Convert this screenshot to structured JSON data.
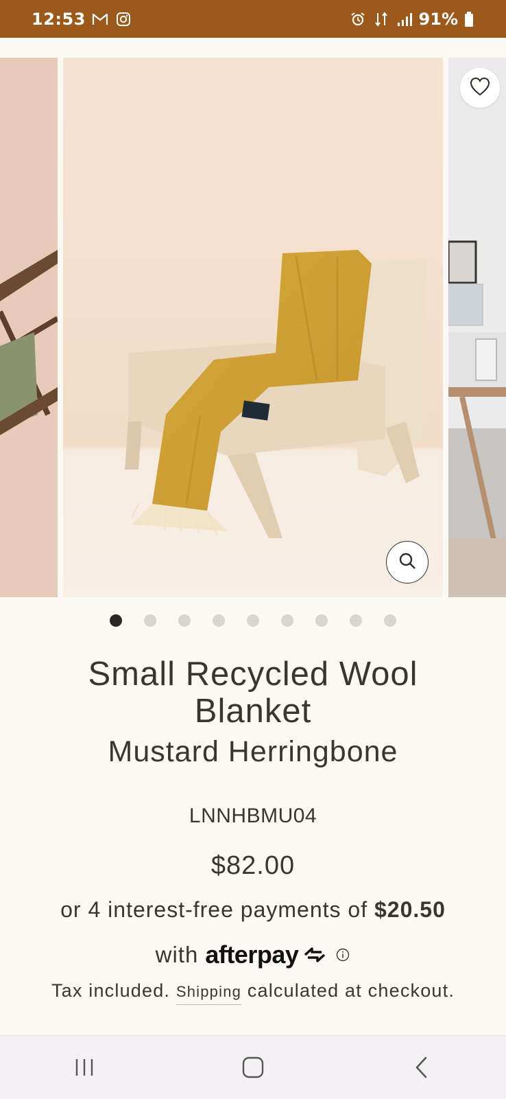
{
  "status_bar": {
    "time": "12:53",
    "battery": "91%",
    "left_icons": [
      "gmail-icon",
      "instagram-icon"
    ],
    "right_icons": [
      "alarm-icon",
      "data-icon",
      "signal-icon",
      "battery-icon"
    ]
  },
  "gallery": {
    "slide_count": 9,
    "active_index": 0,
    "wishlist_icon": "heart-icon",
    "zoom_icon": "magnifier-icon"
  },
  "product": {
    "title": "Small Recycled Wool Blanket",
    "variant": "Mustard Herringbone",
    "sku": "LNNHBMU04",
    "price": "$82.00"
  },
  "afterpay": {
    "text_before": "or 4 interest-free payments of ",
    "amount": "$20.50",
    "with_label": "with",
    "brand": "afterpay"
  },
  "tax": {
    "prefix": "Tax included.",
    "shipping_link": "Shipping",
    "suffix": "calculated at checkout."
  },
  "nav_bar": {
    "icons": [
      "recents-icon",
      "home-icon",
      "back-icon"
    ]
  },
  "colors": {
    "status_bar": "#9b5a1c",
    "background": "#fcf9f4",
    "text": "#3a3530",
    "dot_active": "#2b2724",
    "dot_inactive": "#d9d6d2"
  }
}
